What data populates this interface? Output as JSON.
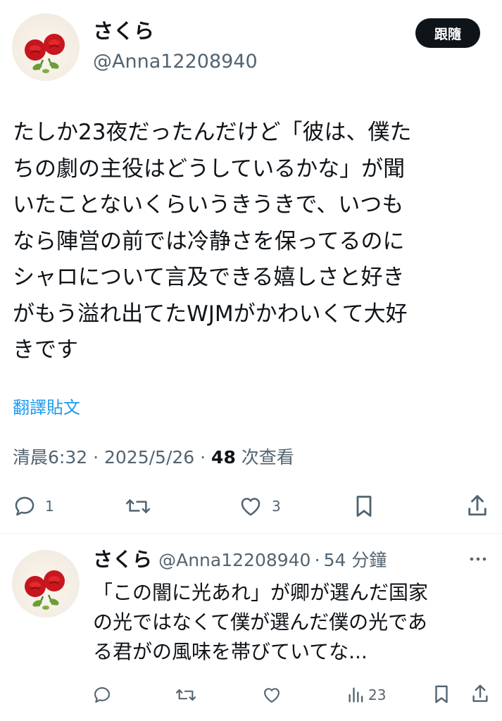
{
  "tweet": {
    "author_name": "さくら",
    "author_handle": "@Anna12208940",
    "follow_label": "跟隨",
    "text_lines": [
      "たしか23夜だったんだけど「彼は、僕た",
      "ちの劇の主役はどうしているかな」が聞",
      "いたことないくらいうきうきで、いつも",
      "なら陣営の前では冷静さを保ってるのに",
      "シャロについて言及できる嬉しさと好き",
      "がもう溢れ出てたWJMがかわいくて大好",
      "きです"
    ],
    "translate_label": "翻譯貼文",
    "time": "清晨6:32",
    "date": "2025/5/26",
    "views_count": "48",
    "views_label": "次查看",
    "reply_count": "1",
    "like_count": "3"
  },
  "reply": {
    "author_name": "さくら",
    "author_handle": "@Anna12208940",
    "time_ago": "54 分鐘",
    "text_lines": [
      "「この闇に光あれ」が卿が選んだ国家",
      "の光ではなくて僕が選んだ僕の光であ",
      "る君がの風味を帯びていてな..."
    ],
    "views_count": "23"
  },
  "icons": {
    "avatar": "red-roses-avatar",
    "reply": "reply-icon",
    "retweet": "retweet-icon",
    "like": "heart-icon",
    "bookmark": "bookmark-icon",
    "share": "share-icon",
    "more": "more-icon",
    "analytics": "analytics-icon"
  },
  "colors": {
    "text": "#0f1419",
    "secondary": "#536471",
    "link": "#1d9bf0",
    "button_bg": "#0f1419",
    "button_text": "#ffffff",
    "divider": "#eff3f4"
  }
}
